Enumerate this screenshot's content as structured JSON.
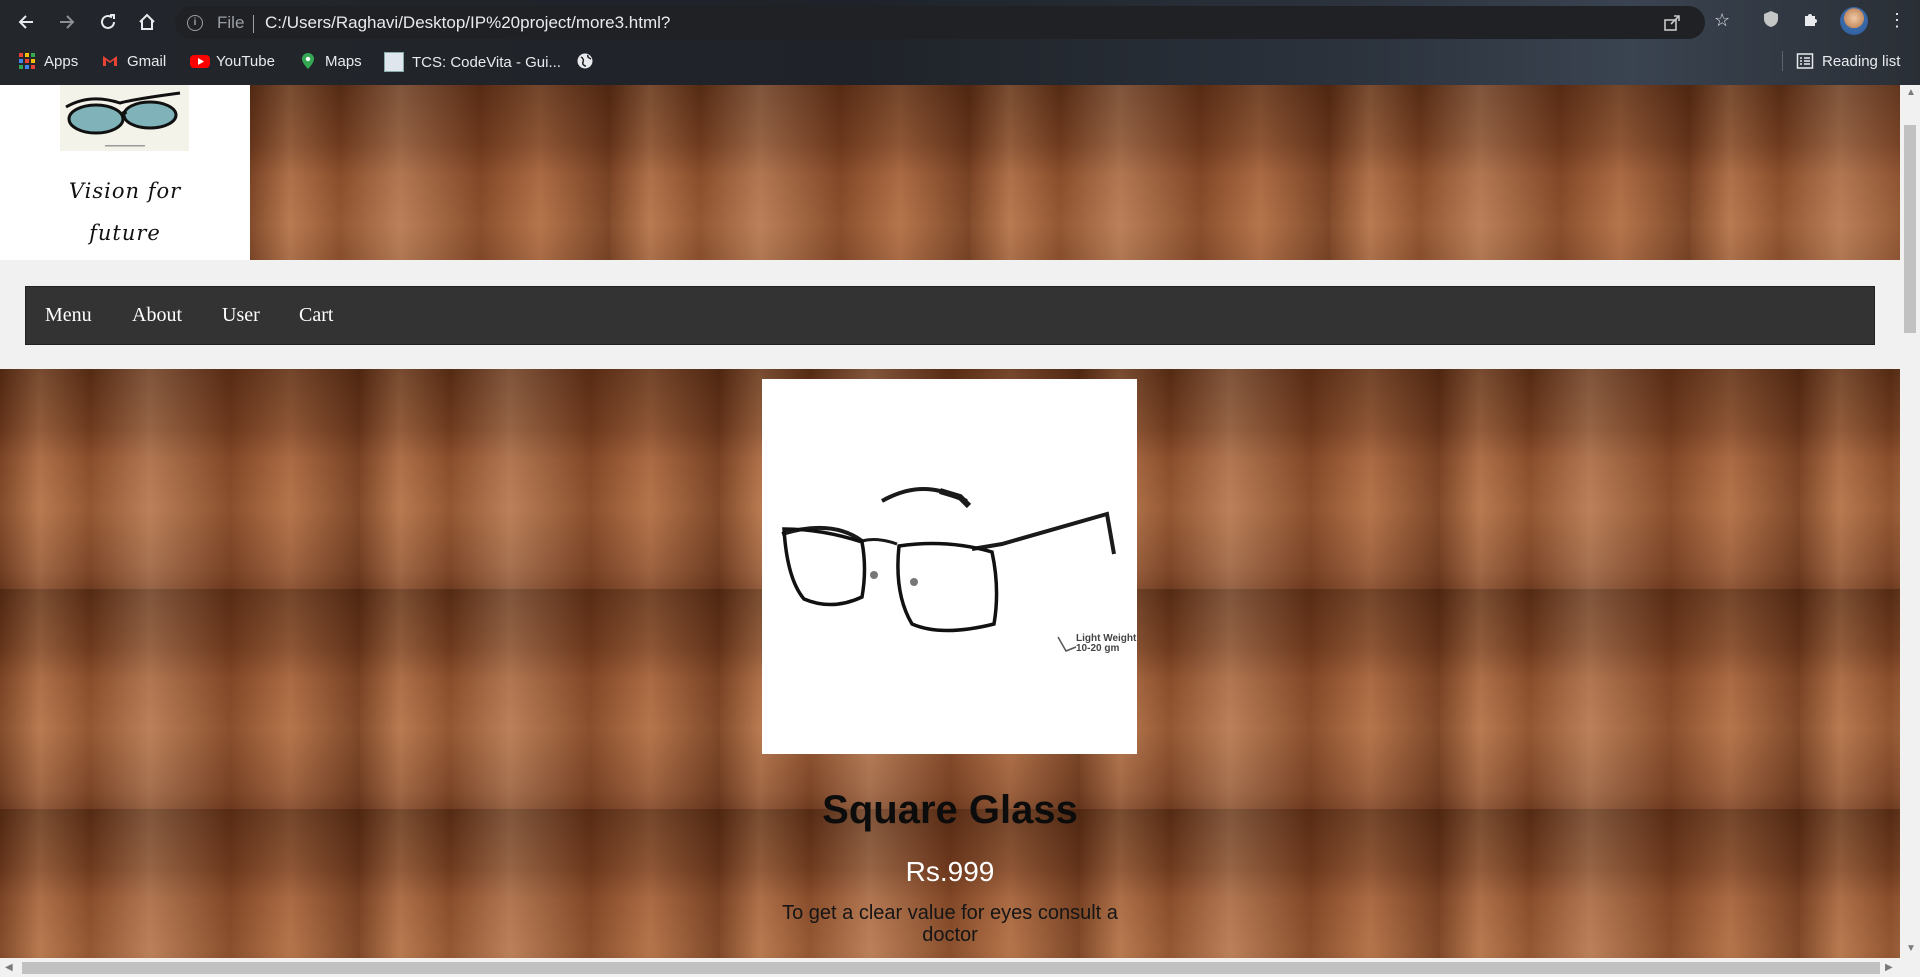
{
  "browser": {
    "scheme_label": "File",
    "url": "C:/Users/Raghavi/Desktop/IP%20project/more3.html?",
    "bookmarks": [
      {
        "label": "Apps",
        "icon": "apps-grid-icon"
      },
      {
        "label": "Gmail",
        "icon": "gmail-icon"
      },
      {
        "label": "YouTube",
        "icon": "youtube-icon"
      },
      {
        "label": "Maps",
        "icon": "maps-pin-icon"
      },
      {
        "label": "TCS: CodeVita - Gui...",
        "icon": "codevita-icon"
      }
    ],
    "reading_list": "Reading list"
  },
  "site": {
    "logo_tagline": "Vision for future",
    "nav": [
      "Menu",
      "About",
      "User",
      "Cart"
    ]
  },
  "product": {
    "name": "Square Glass",
    "price": "Rs.999",
    "badge_line1": "Light Weight",
    "badge_line2": "10-20 gm",
    "description": "To get a clear value for eyes consult a doctor"
  }
}
